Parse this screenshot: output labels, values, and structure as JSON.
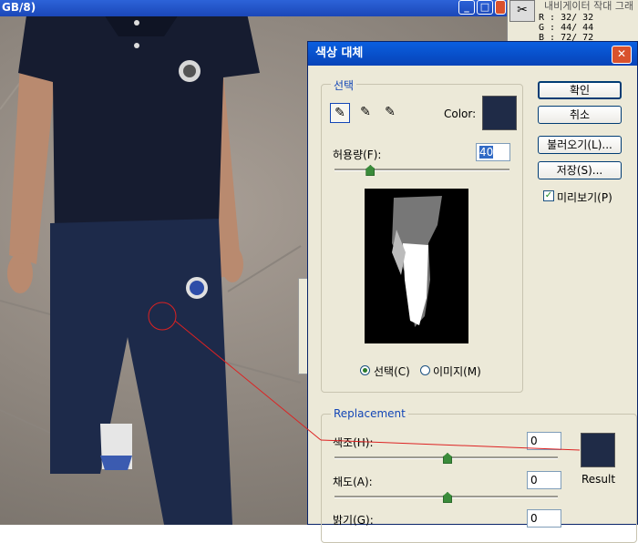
{
  "window": {
    "title_fragment": "GB/8)"
  },
  "nav_panel": {
    "title": "내비게이터  작대  그래",
    "info": [
      "R :    32/  32",
      "G :    44/  44",
      "B :    72/  72"
    ]
  },
  "dialog": {
    "title": "색상 대체",
    "selection": {
      "group_label": "선택",
      "color_label": "Color:",
      "color": "#1f2b47",
      "fuzziness_label": "허용량(F):",
      "fuzziness_value": "40",
      "fuzziness_fraction": 0.2,
      "radio_selection": "선택(C)",
      "radio_image": "이미지(M)"
    },
    "buttons": {
      "ok": "확인",
      "cancel": "취소",
      "load": "불러오기(L)...",
      "save": "저장(S)..."
    },
    "preview_label": "미리보기(P)",
    "replacement": {
      "group_label": "Replacement",
      "hue_label": "색조(H):",
      "hue_value": "0",
      "saturation_label": "채도(A):",
      "saturation_value": "0",
      "lightness_label": "밝기(G):",
      "lightness_value": "0",
      "result_label": "Result",
      "result_color": "#1f2b47"
    }
  }
}
